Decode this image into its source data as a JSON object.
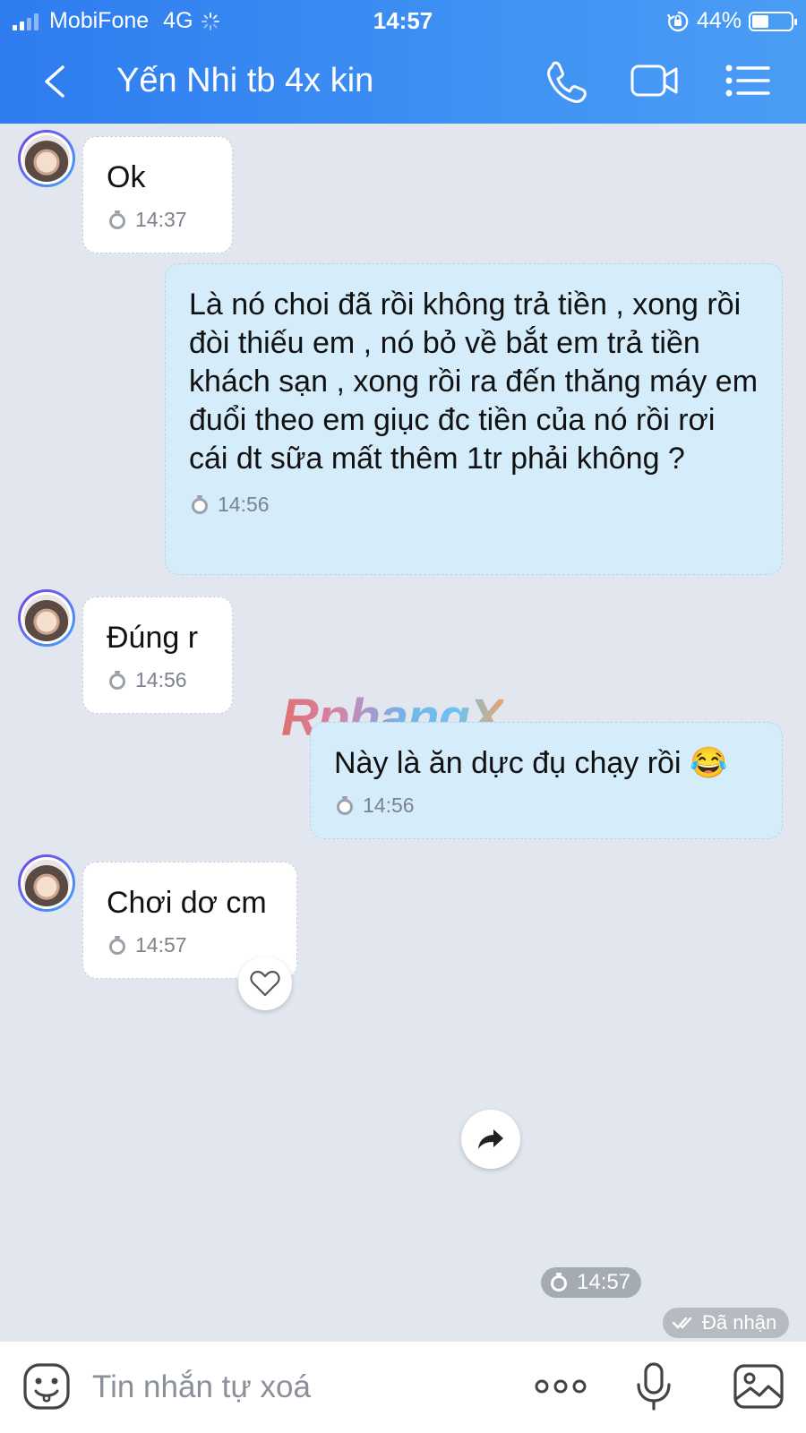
{
  "status_bar": {
    "carrier": "MobiFone",
    "network": "4G",
    "time": "14:57",
    "battery": "44%",
    "battery_level": 0.44
  },
  "header": {
    "title": "Yến Nhi tb 4x kin",
    "icons": [
      "back-icon",
      "phone-icon",
      "video-call-icon",
      "menu-icon"
    ]
  },
  "messages": [
    {
      "direction": "in",
      "text": "Ok",
      "time": "14:37"
    },
    {
      "direction": "out",
      "text": "Là nó choi đã rồi không trả tiền , xong rồi đòi thiếu em , nó bỏ về bắt em trả tiền khách sạn , xong rồi ra đến thăng máy em đuổi theo em giục đc tiền của nó rồi rơi cái dt sữa mất thêm 1tr phải không ?",
      "time": "14:56"
    },
    {
      "direction": "in",
      "text": "Đúng r",
      "time": "14:56"
    },
    {
      "direction": "out",
      "text": "Này là ăn dực đụ chạy rồi 😂",
      "time": "14:56"
    },
    {
      "direction": "in",
      "text": "Chơi dơ cm",
      "time": "14:57"
    }
  ],
  "watermark": "RphangX",
  "time_pill": "14:57",
  "receipt": "Đã nhận",
  "composer": {
    "placeholder": "Tin nhắn tự xoá",
    "icons": [
      "emoji-icon",
      "more-icon",
      "microphone-icon",
      "image-icon"
    ]
  },
  "colors": {
    "header_start": "#2e7cf0",
    "header_end": "#4a9df4",
    "background": "#e2e7ef",
    "outgoing_bubble": "#d5ecfb",
    "incoming_bubble": "#ffffff"
  }
}
